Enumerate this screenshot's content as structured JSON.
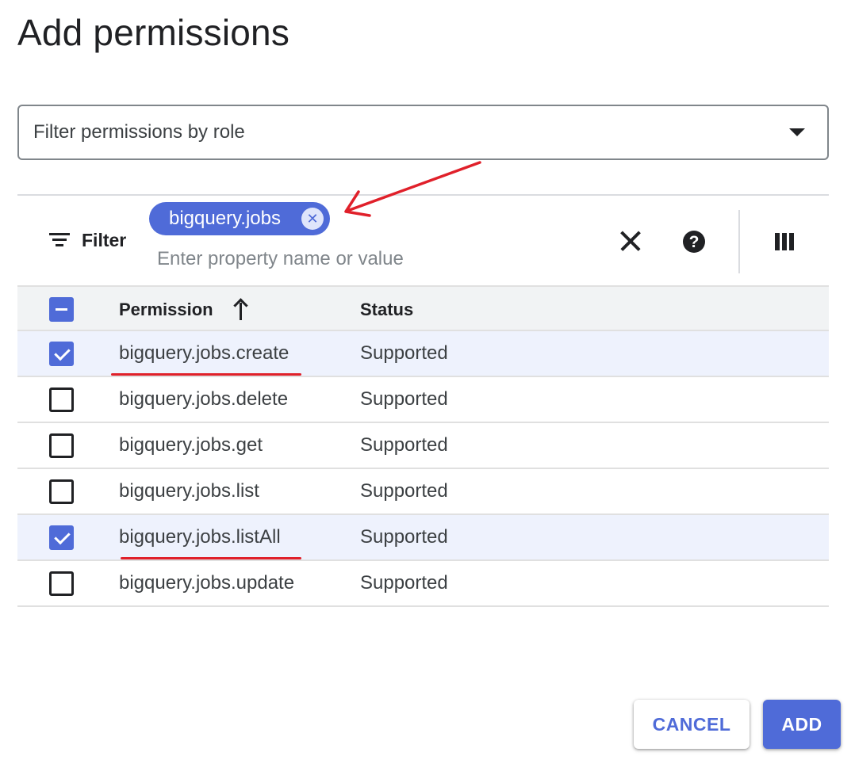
{
  "dialog": {
    "title": "Add permissions"
  },
  "role_filter": {
    "placeholder": "Filter permissions by role"
  },
  "filter_bar": {
    "label": "Filter",
    "chip": {
      "label": "bigquery.jobs"
    },
    "input_placeholder": "Enter property name or value"
  },
  "table": {
    "header": {
      "permission": "Permission",
      "status": "Status",
      "sort": "ascending"
    },
    "rows": [
      {
        "permission": "bigquery.jobs.create",
        "status": "Supported",
        "checked": true
      },
      {
        "permission": "bigquery.jobs.delete",
        "status": "Supported",
        "checked": false
      },
      {
        "permission": "bigquery.jobs.get",
        "status": "Supported",
        "checked": false
      },
      {
        "permission": "bigquery.jobs.list",
        "status": "Supported",
        "checked": false
      },
      {
        "permission": "bigquery.jobs.listAll",
        "status": "Supported",
        "checked": true
      },
      {
        "permission": "bigquery.jobs.update",
        "status": "Supported",
        "checked": false
      }
    ]
  },
  "actions": {
    "cancel_label": "CANCEL",
    "add_label": "ADD"
  },
  "colors": {
    "accent": "#4f6bd8",
    "annotation": "#e0202a",
    "selected_row": "#eef2fd"
  }
}
